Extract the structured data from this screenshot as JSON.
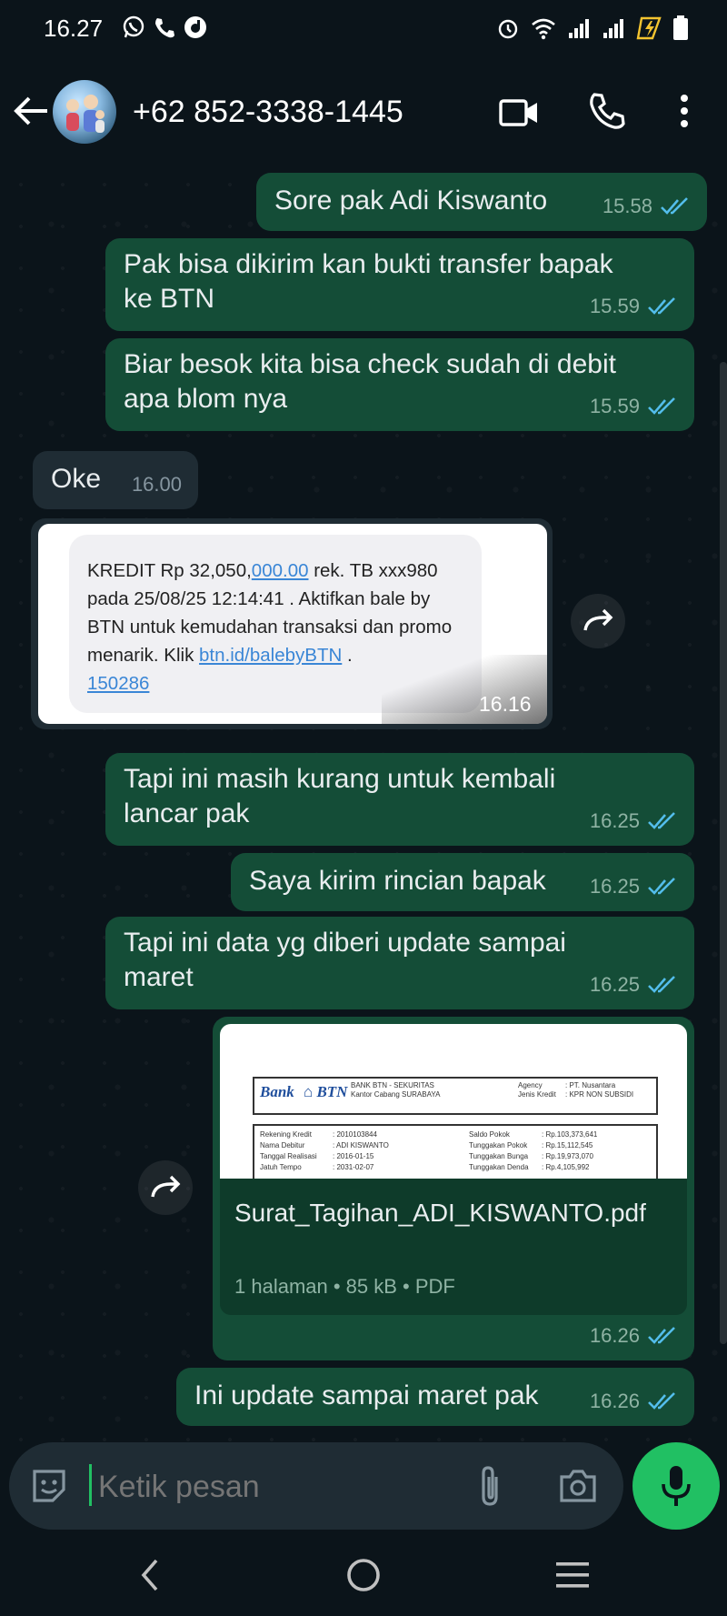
{
  "status_bar": {
    "time": "16.27"
  },
  "header": {
    "contact": "+62 852-3338-1445"
  },
  "messages": [
    {
      "text": "Sore pak Adi Kiswanto",
      "time": "15.58"
    },
    {
      "text": "Pak bisa dikirim kan bukti transfer bapak ke BTN",
      "time": "15.59"
    },
    {
      "text": "Biar besok kita bisa check sudah di debit apa blom nya",
      "time": "15.59"
    },
    {
      "text": "Oke",
      "time": "16.00"
    },
    {
      "time": "16.16",
      "sms": {
        "part1": "KREDIT Rp 32,050,",
        "link1": "000.00",
        "part2": " rek. TB xxx980 pada 25/08/25 12:14:41 . Aktifkan bale by BTN untuk kemudahan transaksi dan promo menarik. Klik ",
        "link2": "btn.id/balebyBTN",
        "part3": " .",
        "link3": "150286"
      }
    },
    {
      "text": "Tapi ini masih kurang untuk kembali lancar pak",
      "time": "16.25"
    },
    {
      "text": "Saya kirim rincian bapak",
      "time": "16.25"
    },
    {
      "text": "Tapi ini data yg diberi update sampai maret",
      "time": "16.25"
    },
    {
      "time": "16.26",
      "file": {
        "name": "Surat_Tagihan_ADI_KISWANTO.pdf",
        "info": "1 halaman • 85 kB • PDF",
        "preview": {
          "bank": "Bank",
          "brand": "BTN",
          "hdr1": "BANK BTN - SEKURITAS",
          "hdr2": "Kantor Cabang SURABAYA",
          "agency_l": "Agency",
          "agency_v": ": PT. Nusantara",
          "jenis_l": "Jenis Kredit",
          "jenis_v": ": KPR NON SUBSIDI",
          "rows_left": [
            [
              "Rekening Kredit",
              ": 2010103844"
            ],
            [
              "Nama Debitur",
              ": ADI KISWANTO"
            ],
            [
              "Tanggal Realisasi",
              ": 2016-01-15"
            ],
            [
              "Jatuh Tempo",
              ": 2031-02-07"
            ]
          ],
          "rows_right": [
            [
              "Saldo Pokok",
              ": Rp.103,373,641"
            ],
            [
              "Tunggakan Pokok",
              ": Rp.15,112,545"
            ],
            [
              "Tunggakan Bunga",
              ": Rp.19,973,070"
            ],
            [
              "Tunggakan Denda",
              ": Rp.4,105,992"
            ]
          ]
        }
      }
    },
    {
      "text": "Ini update sampai maret pak",
      "time": "16.26"
    }
  ],
  "input": {
    "placeholder": "Ketik pesan"
  }
}
